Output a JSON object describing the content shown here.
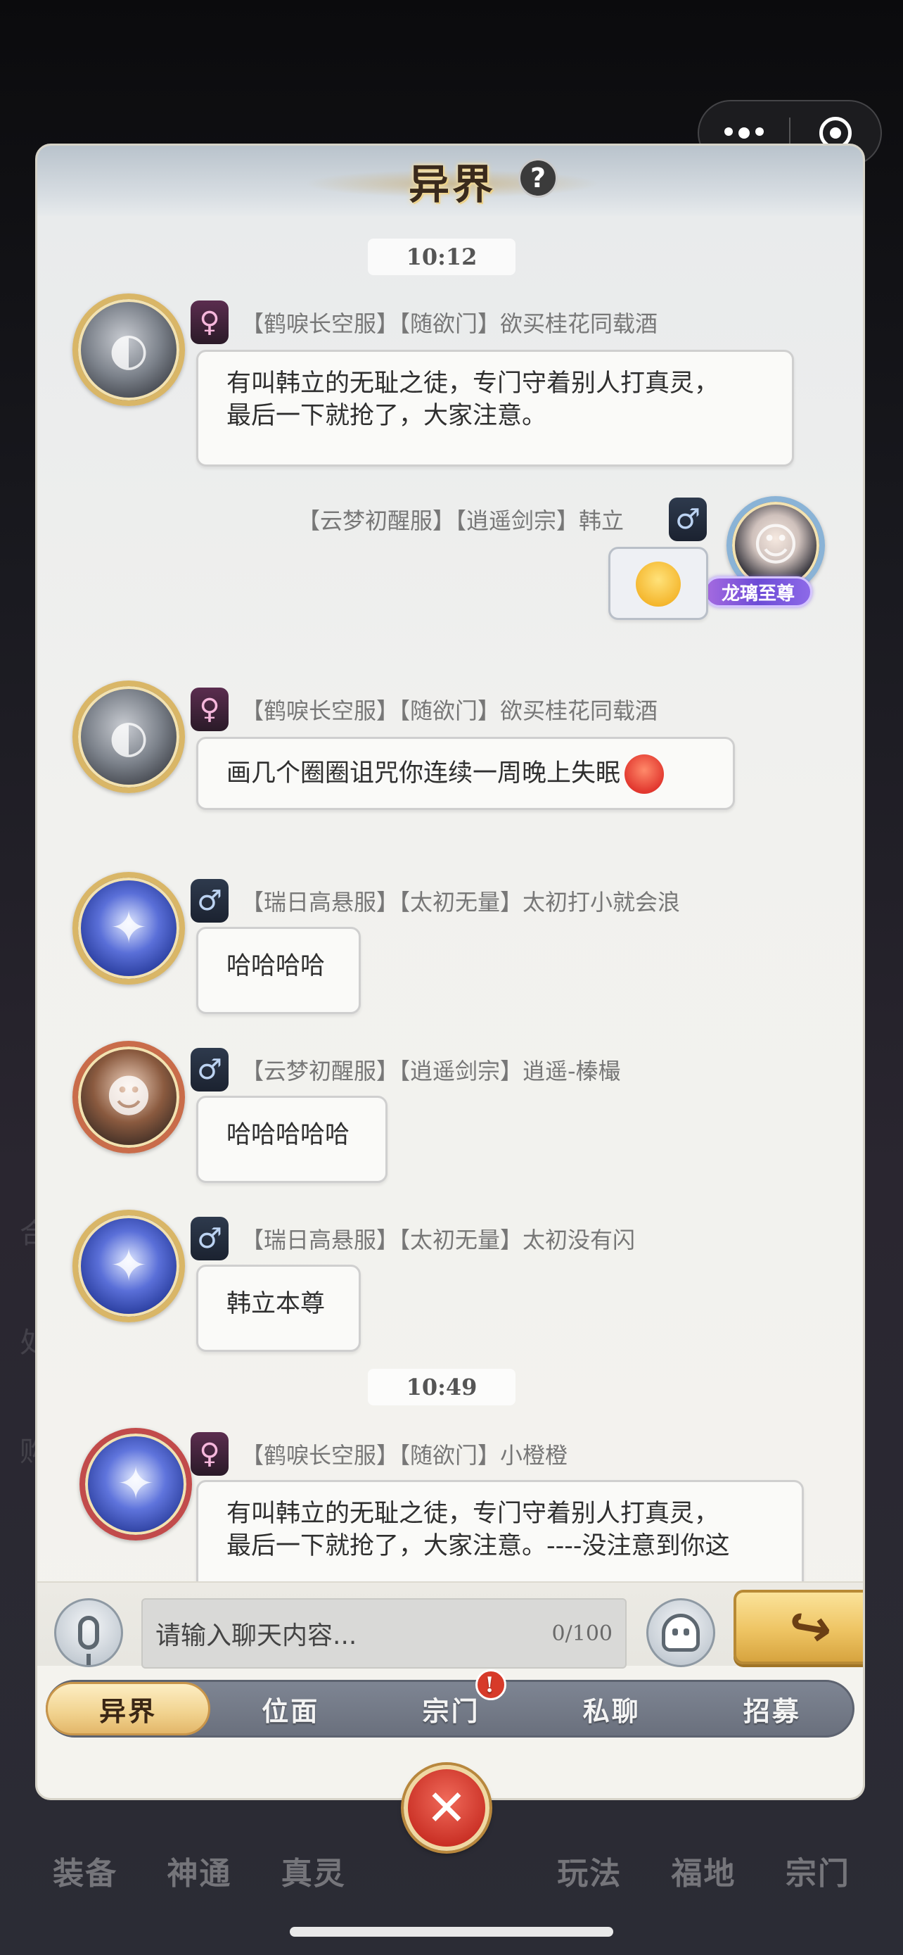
{
  "capsule": {
    "more_icon": "more-dots-icon",
    "close_icon": "target-icon"
  },
  "dialog": {
    "title": "异界",
    "help": "?"
  },
  "chat": {
    "time1": "10:12",
    "time2": "10:49",
    "messages": [
      {
        "sender": "【鹤唳长空服】【随欲门】欲买桂花同载酒",
        "gender": "♀",
        "text_line1": "有叫韩立的无耻之徒，专门守着别人打真灵，",
        "text_line2": "最后一下就抢了，大家注意。"
      },
      {
        "sender": "【云梦初醒服】【逍遥剑宗】韩立",
        "gender": "♂",
        "title_banner": "龙璃至尊",
        "emoji": "😂"
      },
      {
        "sender": "【鹤唳长空服】【随欲门】欲买桂花同载酒",
        "gender": "♀",
        "text": "画几个圈圈诅咒你连续一周晚上失眠"
      },
      {
        "sender": "【瑞日高悬服】【太初无量】太初打小就会浪",
        "gender": "♂",
        "text": "哈哈哈哈"
      },
      {
        "sender": "【云梦初醒服】【逍遥剑宗】逍遥-榛樶",
        "gender": "♂",
        "text": "哈哈哈哈哈"
      },
      {
        "sender": "【瑞日高悬服】【太初无量】太初没有闪",
        "gender": "♂",
        "text": "韩立本尊"
      },
      {
        "sender": "【鹤唳长空服】【随欲门】小橙橙",
        "gender": "♀",
        "text_line1": "有叫韩立的无耻之徒，专门守着别人打真灵，",
        "text_line2": "最后一下就抢了，大家注意。----没注意到你这"
      }
    ]
  },
  "input": {
    "placeholder": "请输入聊天内容...",
    "count": "0/100"
  },
  "tabs": [
    "异界",
    "位面",
    "宗门",
    "私聊",
    "招募"
  ],
  "tab_alert": "!",
  "close_label": "✕",
  "background_nav": [
    "装备",
    "神通",
    "真灵",
    "玩法",
    "福地",
    "宗门"
  ]
}
